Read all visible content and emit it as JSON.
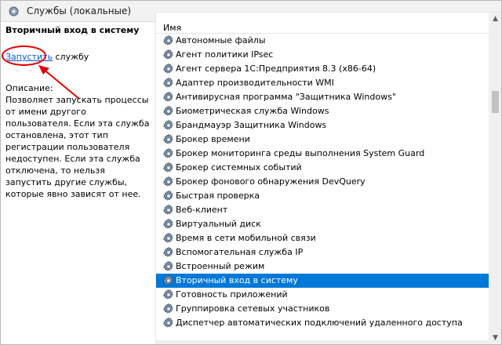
{
  "window": {
    "title": "Службы (локальные)"
  },
  "left_pane": {
    "service_name": "Вторичный вход в систему",
    "start_link": "Запустить",
    "start_suffix": "службу",
    "description_label": "Описание:",
    "description": "Позволяет запускать процессы от имени другого пользователя. Если эта служба остановлена, этот тип регистрации пользователя недоступен. Если эта служба отключена, то нельзя запустить другие службы, которые явно зависят от нее."
  },
  "list": {
    "column_name": "Имя",
    "items": [
      "Автономные файлы",
      "Агент политики IPsec",
      "Агент сервера 1С:Предприятия 8.3 (x86-64)",
      "Адаптер производительности WMI",
      "Антивирусная программа \"Защитника Windows\"",
      "Биометрическая служба Windows",
      "Брандмауэр Защитника Windows",
      "Брокер времени",
      "Брокер мониторинга среды выполнения System Guard",
      "Брокер системных событий",
      "Брокер фонового обнаружения DevQuery",
      "Быстрая проверка",
      "Веб-клиент",
      "Виртуальный диск",
      "Время в сети мобильной связи",
      "Вспомогательная служба IP",
      "Встроенный режим",
      "Вторичный вход в систему",
      "Готовность приложений",
      "Группировка сетевых участников",
      "Диспетчер автоматических подключений удаленного доступа"
    ],
    "selected_index": 17
  },
  "colors": {
    "selection": "#0078d7",
    "link": "#0b57d0",
    "highlight_annotation": "#e00000"
  },
  "icons": {
    "title": "services-icon",
    "row": "gear-icon"
  }
}
